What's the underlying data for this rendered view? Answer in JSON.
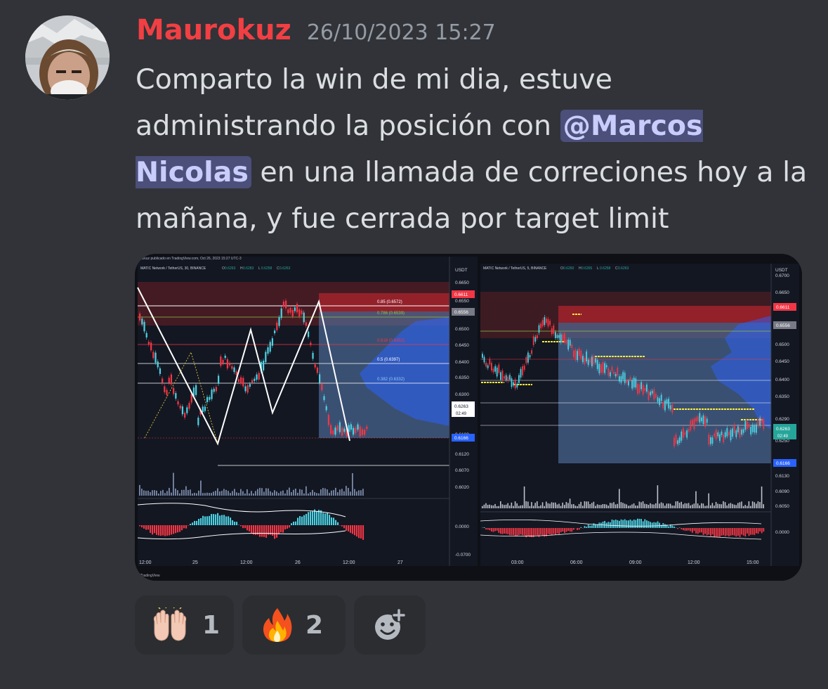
{
  "message": {
    "username": "Maurokuz",
    "timestamp": "26/10/2023 15:27",
    "text_before_mention": "Comparto la win de mi dia, estuve administrando la posición con ",
    "mention": "@Marcos Nicolas",
    "text_after_mention": " en una llamada de correciones hoy a la mañana, y fue cerrada por target limit"
  },
  "attachment": {
    "left_chart": {
      "header": "uzkuz publicado en TradingView.com, Oct 26, 2023 15:27 UTC-3",
      "symbol": "MATIC Network / TetherUS, 30, BINANCE",
      "ohlc": {
        "o": "0.6263",
        "h": "0.6283",
        "l": "0.6258",
        "c": "0.6263"
      },
      "currency": "USDT",
      "price_ticks": [
        "0.6650",
        "0.6550",
        "0.6500",
        "0.6450",
        "0.6400",
        "0.6350",
        "0.6300",
        "0.6180",
        "0.6120",
        "0.6070",
        "0.6020"
      ],
      "price_badges": {
        "high": "0.6611",
        "mid": "0.6556",
        "current": "0.6263",
        "countdown": "02:49",
        "low": "0.6166"
      },
      "fib_levels": [
        "0.85 (0.6572)",
        "0.786 (0.6539)",
        "0.618 (0.6452)",
        "0.5 (0.6397)",
        "0.382 (0.6332)"
      ],
      "osc_ticks": [
        "0.0000",
        "-0.0700"
      ],
      "time_ticks": [
        "12:00",
        "25",
        "12:00",
        "26",
        "12:00",
        "27"
      ],
      "footer": "TradingView"
    },
    "right_chart": {
      "symbol": "MATIC Network / TetherUS, 5, BINANCE",
      "ohlc": {
        "o": "0.6260",
        "h": "0.6265",
        "l": "0.6258",
        "c": "0.6263"
      },
      "currency": "USDT",
      "price_ticks": [
        "0.6700",
        "0.6650",
        "0.6500",
        "0.6450",
        "0.6400",
        "0.6350",
        "0.6290",
        "0.6250",
        "0.6130",
        "0.6090",
        "0.6050"
      ],
      "price_badges": {
        "high": "0.6611",
        "mid": "0.6556",
        "current": "0.6263",
        "countdown": "02:49",
        "low": "0.6166"
      },
      "osc_ticks": [
        "0.0000"
      ],
      "time_ticks": [
        "03:00",
        "06:00",
        "09:00",
        "12:00",
        "15:00"
      ]
    }
  },
  "reactions": [
    {
      "emoji": "raising-hands",
      "count": "1"
    },
    {
      "emoji": "fire",
      "count": "2"
    }
  ],
  "add_reaction": {
    "icon": "add-reaction-icon"
  }
}
